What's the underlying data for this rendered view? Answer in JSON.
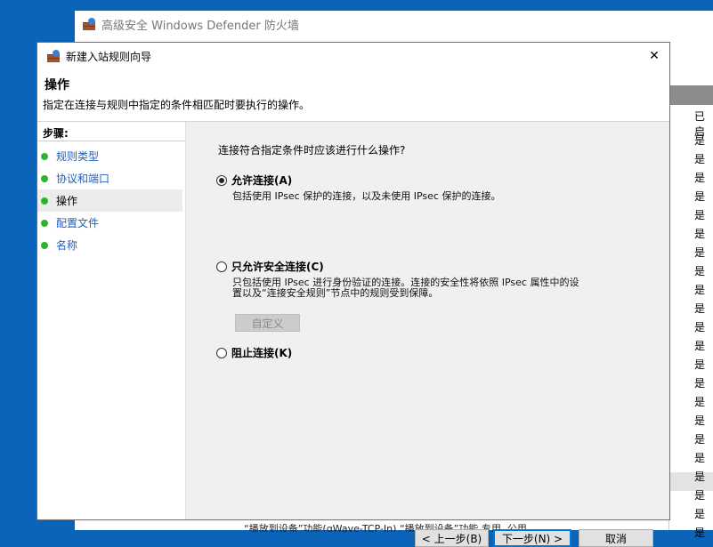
{
  "main_window": {
    "title": "高级安全 Windows Defender 防火墙",
    "column_header": "已启",
    "column_values": [
      "是",
      "是",
      "是",
      "是",
      "是",
      "是",
      "是",
      "是",
      "是",
      "是",
      "是",
      "是",
      "是",
      "是",
      "是",
      "是",
      "是",
      "是",
      "是",
      "是",
      "是",
      "是"
    ],
    "bottom_row_text": "“播放到设备”功能(qWave-TCP-In)     “播放到设备”功能        专用, 公用"
  },
  "dialog": {
    "title": "新建入站规则向导",
    "close_symbol": "✕",
    "header_title": "操作",
    "header_desc": "指定在连接与规则中指定的条件相匹配时要执行的操作。",
    "steps_title": "步骤:",
    "steps": [
      {
        "label": "规则类型",
        "active": false
      },
      {
        "label": "协议和端口",
        "active": false
      },
      {
        "label": "操作",
        "active": true
      },
      {
        "label": "配置文件",
        "active": false
      },
      {
        "label": "名称",
        "active": false
      }
    ],
    "question": "连接符合指定条件时应该进行什么操作?",
    "options": [
      {
        "label": "允许连接(A)",
        "selected": true,
        "desc": [
          "包括使用 IPsec 保护的连接，以及未使用 IPsec 保护的连接。"
        ]
      },
      {
        "label": "只允许安全连接(C)",
        "selected": false,
        "desc": [
          "只包括使用 IPsec 进行身份验证的连接。连接的安全性将依照 IPsec 属性中的设",
          "置以及“连接安全规则”节点中的规则受到保障。"
        ]
      },
      {
        "label": "阻止连接(K)",
        "selected": false,
        "desc": []
      }
    ],
    "customize_button": "自定义",
    "back_button": "< 上一步(B)",
    "next_button": "下一步(N) >",
    "cancel_button": "取消",
    "step_dot_color": "#2fb32f",
    "accent_color": "#0078d7"
  }
}
